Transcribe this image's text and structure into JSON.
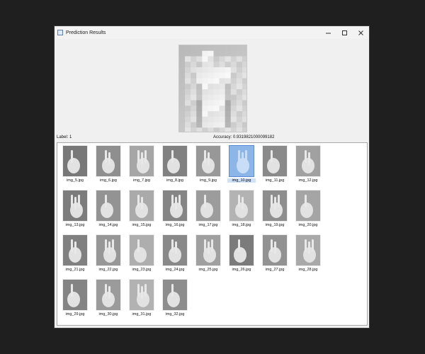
{
  "window": {
    "title": "Prediction Results",
    "minimize_label": "minimize",
    "maximize_label": "maximize",
    "close_label": "close"
  },
  "prediction": {
    "label": "Label: 1",
    "accuracy": "Accuracy: 0.9319821000099182"
  },
  "images": [
    {
      "name": "img_5.jpg",
      "selected": false
    },
    {
      "name": "img_6.jpg",
      "selected": false
    },
    {
      "name": "img_7.jpg",
      "selected": false
    },
    {
      "name": "img_8.jpg",
      "selected": false
    },
    {
      "name": "img_9.jpg",
      "selected": false
    },
    {
      "name": "img_10.jpg",
      "selected": true
    },
    {
      "name": "img_11.jpg",
      "selected": false
    },
    {
      "name": "img_12.jpg",
      "selected": false
    },
    {
      "name": "img_13.jpg",
      "selected": false
    },
    {
      "name": "img_14.jpg",
      "selected": false
    },
    {
      "name": "img_15.jpg",
      "selected": false
    },
    {
      "name": "img_16.jpg",
      "selected": false
    },
    {
      "name": "img_17.jpg",
      "selected": false
    },
    {
      "name": "img_18.jpg",
      "selected": false
    },
    {
      "name": "img_19.jpg",
      "selected": false
    },
    {
      "name": "img_20.jpg",
      "selected": false
    },
    {
      "name": "img_21.jpg",
      "selected": false
    },
    {
      "name": "img_22.jpg",
      "selected": false
    },
    {
      "name": "img_23.jpg",
      "selected": false
    },
    {
      "name": "img_24.jpg",
      "selected": false
    },
    {
      "name": "img_25.jpg",
      "selected": false
    },
    {
      "name": "img_26.jpg",
      "selected": false
    },
    {
      "name": "img_27.jpg",
      "selected": false
    },
    {
      "name": "img_28.jpg",
      "selected": false
    },
    {
      "name": "img_29.jpg",
      "selected": false
    },
    {
      "name": "img_30.jpg",
      "selected": false
    },
    {
      "name": "img_31.jpg",
      "selected": false
    },
    {
      "name": "img_32.jpg",
      "selected": false
    }
  ],
  "colors": {
    "desktop": "#1f1f1f",
    "window_bg": "#f0f0f0",
    "selection": "#9cc3f0",
    "selection_border": "#5b8bd6"
  }
}
